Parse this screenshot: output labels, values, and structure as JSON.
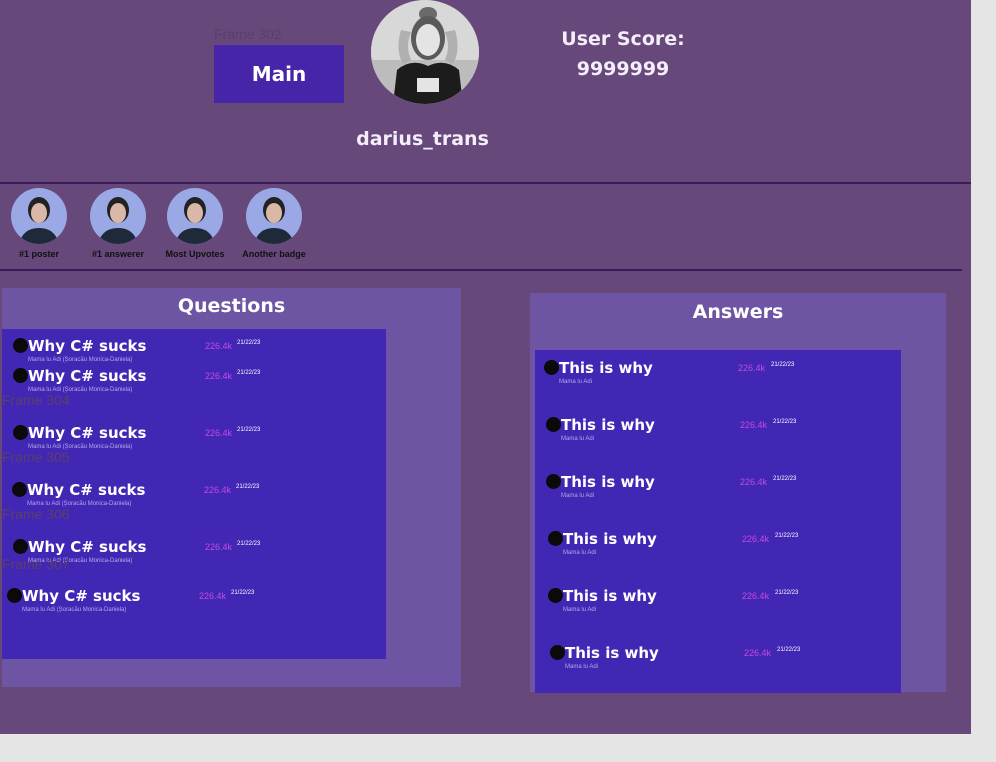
{
  "frame_labels": {
    "main_frame": "Frame 302",
    "q_frames": [
      "Frame 304",
      "Frame 305",
      "Frame 306",
      "Frame 307"
    ]
  },
  "header": {
    "main_button": "Main",
    "username": "darius_trans",
    "score_label": "User Score:",
    "score_value": "9999999"
  },
  "badges": [
    {
      "label": "#1 poster",
      "icon": "badge-avatar-icon"
    },
    {
      "label": "#1 answerer",
      "icon": "badge-avatar-icon"
    },
    {
      "label": "Most Upvotes",
      "icon": "badge-avatar-icon"
    },
    {
      "label": "Another badge",
      "icon": "badge-avatar-icon"
    }
  ],
  "questions": {
    "title": "Questions",
    "items": [
      {
        "title": "Why C# sucks",
        "author": "Mama lu Adi (Șoracău Monica-Daniela)",
        "votes": "226.4k",
        "date": "21/22/23"
      },
      {
        "title": "Why C# sucks",
        "author": "Mama lu Adi (Șoracău Monica-Daniela)",
        "votes": "226.4k",
        "date": "21/22/23"
      },
      {
        "title": "Why C# sucks",
        "author": "Mama lu Adi (Șoracău Monica-Daniela)",
        "votes": "226.4k",
        "date": "21/22/23"
      },
      {
        "title": "Why C# sucks",
        "author": "Mama lu Adi (Șoracău Monica-Daniela)",
        "votes": "226.4k",
        "date": "21/22/23"
      },
      {
        "title": "Why C# sucks",
        "author": "Mama lu Adi (Șoracău Monica-Daniela)",
        "votes": "226.4k",
        "date": "21/22/23"
      },
      {
        "title": "Why C# sucks",
        "author": "Mama lu Adi (Șoracău Monica-Daniela)",
        "votes": "226.4k",
        "date": "21/22/23"
      }
    ]
  },
  "answers": {
    "title": "Answers",
    "items": [
      {
        "title": "This is why",
        "author": "Mama lu Adi",
        "votes": "226.4k",
        "date": "21/22/23"
      },
      {
        "title": "This is why",
        "author": "Mama lu Adi",
        "votes": "226.4k",
        "date": "21/22/23"
      },
      {
        "title": "This is why",
        "author": "Mama lu Adi",
        "votes": "226.4k",
        "date": "21/22/23"
      },
      {
        "title": "This is why",
        "author": "Mama lu Adi",
        "votes": "226.4k",
        "date": "21/22/23"
      },
      {
        "title": "This is why",
        "author": "Mama lu Adi",
        "votes": "226.4k",
        "date": "21/22/23"
      },
      {
        "title": "This is why",
        "author": "Mama lu Adi",
        "votes": "226.4k",
        "date": "21/22/23"
      }
    ]
  },
  "colors": {
    "background": "#66487a",
    "panel": "#6d55a3",
    "list": "#4227b5",
    "button": "#4625a8",
    "votes": "#c34be0"
  }
}
